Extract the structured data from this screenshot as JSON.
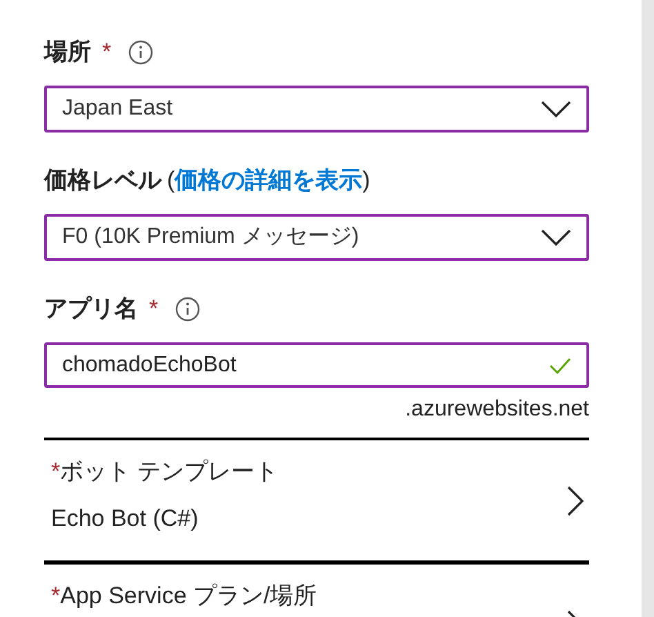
{
  "required_mark": "*",
  "fields": [
    {
      "kind": "select",
      "label": "場所",
      "required": true,
      "info": true,
      "value": "Japan East"
    },
    {
      "kind": "select",
      "label": "価格レベル",
      "required": false,
      "info": false,
      "link_open": "(",
      "link": "価格の詳細を表示",
      "link_close": ")",
      "value": "F0 (10K Premium メッセージ)"
    },
    {
      "kind": "text",
      "label": "アプリ名",
      "required": true,
      "info": true,
      "value": "chomadoEchoBot",
      "valid": true,
      "suffix": ".azurewebsites.net"
    }
  ],
  "nav_items": [
    {
      "label": "ボット テンプレート",
      "required": true,
      "value": "Echo Bot (C#)"
    },
    {
      "label": "App Service プラン/場所",
      "required": true
    }
  ]
}
